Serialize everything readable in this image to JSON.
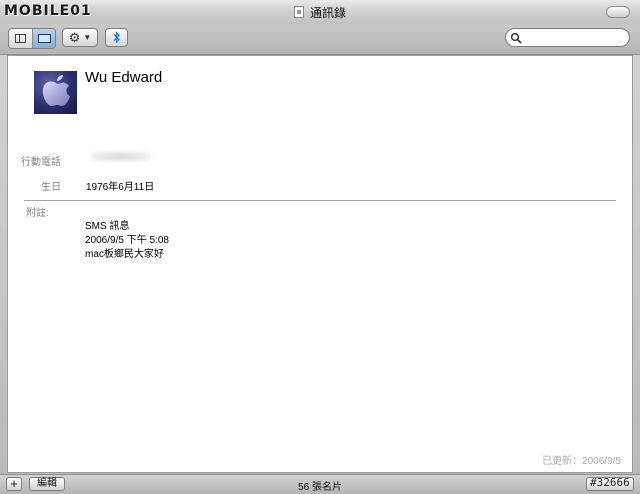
{
  "window": {
    "title": "通訊錄",
    "watermark": "MOBILE01"
  },
  "toolbar": {
    "view_buttons": [
      "list-view",
      "card-view"
    ],
    "active_view": "card-view",
    "action_icon": "gear-icon",
    "bluetooth_icon": "bluetooth-icon",
    "search": {
      "value": "",
      "placeholder": ""
    }
  },
  "contact": {
    "name": "Wu Edward",
    "avatar_icon": "apple-logo-avatar",
    "fields": [
      {
        "label": "行動電話",
        "value_blurred": true
      },
      {
        "label": "生日",
        "value": "1976年6月11日"
      }
    ],
    "note": {
      "label": "附註:",
      "lines": [
        "SMS 訊息",
        "2006/9/5 下午 5:08",
        "mac板鄉民大家好"
      ]
    },
    "updated": "已更新：2006/9/5"
  },
  "bottombar": {
    "add_label": "+",
    "edit_label": "編輯",
    "count": "56 張名片"
  },
  "stamp": "#32666",
  "colors": {
    "active_segment": "#88aed6",
    "bluetooth": "#2a7be0"
  }
}
